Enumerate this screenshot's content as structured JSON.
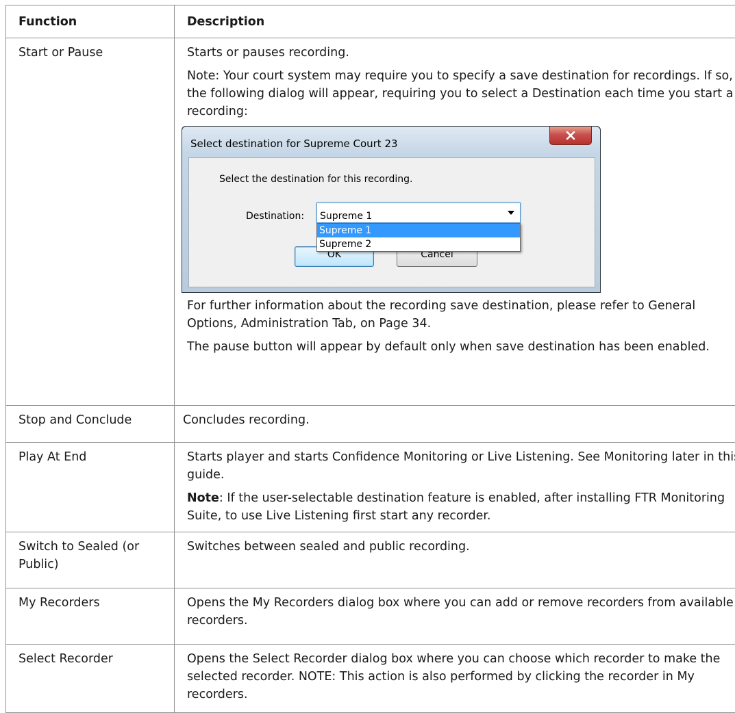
{
  "table": {
    "headers": {
      "function": "Function",
      "description": "Description"
    },
    "rows": [
      {
        "function": "Start or Pause",
        "desc_p1": "Starts or pauses recording.",
        "desc_p2": "Note: Your court system may require you to specify a save destination for recordings. If so, the following dialog will appear, requiring you to select a Destination each time you start a recording:",
        "desc_p3": "For further information about the recording save destination, please refer to General Options, Administration Tab, on Page 34.",
        "desc_p4": "The pause button will appear by default only when save destination has been enabled."
      },
      {
        "function": "Stop and Conclude",
        "desc_p1": "Concludes recording."
      },
      {
        "function": "Play At End",
        "desc_p1": "Starts player and starts Confidence Monitoring or Live Listening. See Monitoring later in this guide.",
        "note_label": "Note",
        "note_text": ": If the user-selectable destination feature is enabled, after installing FTR Monitoring Suite, to use Live Listening first start any recorder."
      },
      {
        "function": "Switch to Sealed (or Public)",
        "desc_p1": "Switches between sealed and public recording."
      },
      {
        "function": "My Recorders",
        "desc_p1": "Opens the My Recorders dialog box where you can add or remove recorders from available recorders."
      },
      {
        "function": "Select Recorder",
        "desc_p1": "Opens the Select Recorder dialog box where you can choose which recorder to make the selected recorder. NOTE: This action is also performed by clicking the recorder in My recorders."
      }
    ]
  },
  "dialog": {
    "title": "Select destination for Supreme Court 23",
    "prompt": "Select the destination for this recording.",
    "destination_label": "Destination:",
    "selected_value": "Supreme 1",
    "options": [
      "Supreme 1",
      "Supreme 2"
    ],
    "ok_label": "OK",
    "cancel_label": "Cancel",
    "close_icon": "close-x-icon",
    "highlight_color": "#3399ff",
    "close_color": "#c75050"
  }
}
